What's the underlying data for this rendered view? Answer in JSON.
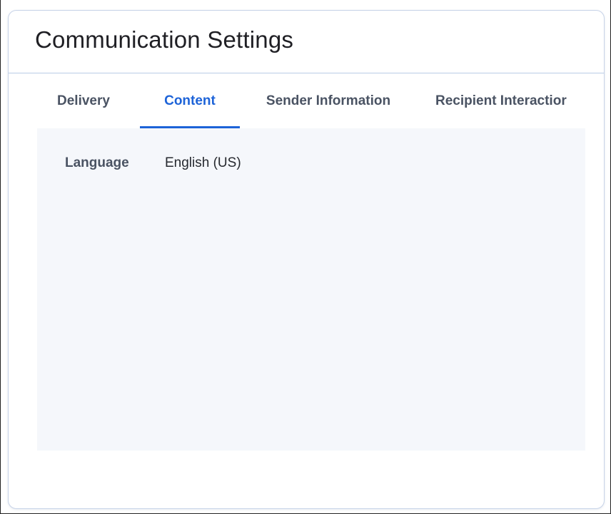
{
  "card": {
    "title": "Communication Settings"
  },
  "tabs": [
    {
      "label": "Delivery",
      "active": false
    },
    {
      "label": "Content",
      "active": true
    },
    {
      "label": "Sender Information",
      "active": false
    },
    {
      "label": "Recipient Interactior",
      "active": false
    }
  ],
  "content": {
    "settings": [
      {
        "label": "Language",
        "value": "English (US)"
      }
    ]
  },
  "colors": {
    "accent": "#1d63d8",
    "tab_text": "#4a5363",
    "panel_background": "#f5f7fb",
    "card_border": "#c7d3e8"
  }
}
